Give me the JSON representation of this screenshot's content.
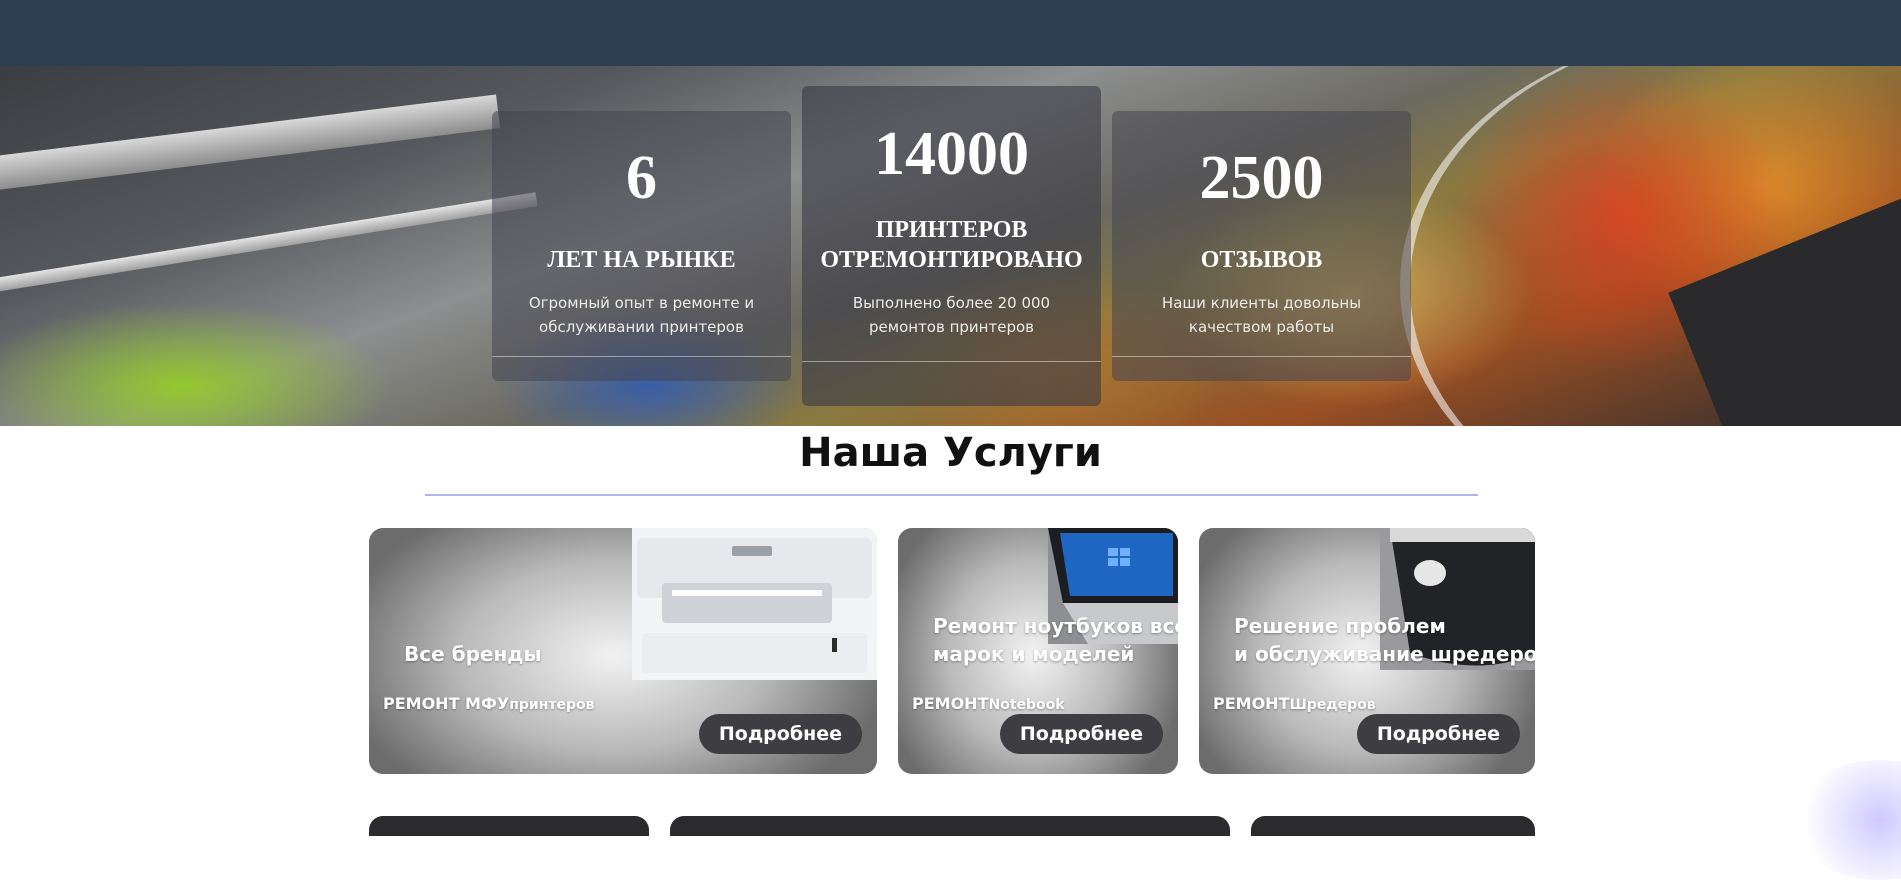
{
  "stats": [
    {
      "number": "6",
      "title": "ЛЕТ НА РЫНКЕ",
      "description": "Огромный опыт в ремонте и обслуживании принтеров"
    },
    {
      "number": "14000",
      "title": "ПРИНТЕРОВ ОТРЕМОНТИРОВАНО",
      "description": "Выполнено более 20 000 ремонтов принтеров"
    },
    {
      "number": "2500",
      "title": "ОТЗЫВОВ",
      "description": "Наши клиенты довольны качеством работы"
    }
  ],
  "services_section": {
    "title": "Наша Услуги",
    "accent_color": "#b5b3ec"
  },
  "services": [
    {
      "headline_line1": "Все бренды",
      "headline_line2": "",
      "label_main": "РЕМОНТ МФУ",
      "label_small": "принтеров",
      "button": "Подробнее",
      "icon": "printer-icon"
    },
    {
      "headline_line1": "Ремонт ноутбуков всех",
      "headline_line2": "марок и моделей",
      "label_main": "РЕМОНТ",
      "label_small": "Notebook",
      "button": "Подробнее",
      "icon": "laptop-icon"
    },
    {
      "headline_line1": "Решение проблем",
      "headline_line2": "и обслуживание шредеров",
      "label_main": "РЕМОНТ",
      "label_small": "Шредеров",
      "button": "Подробнее",
      "icon": "shredder-icon"
    }
  ],
  "colors": {
    "header": "#2c3e50",
    "button": "#3d3d42"
  }
}
